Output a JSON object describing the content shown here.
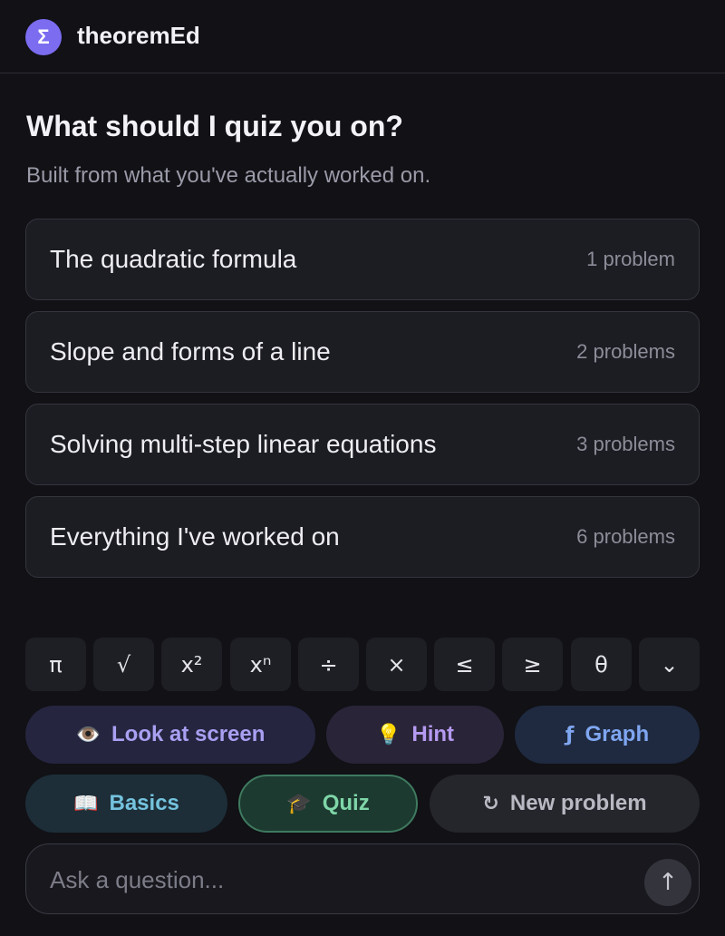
{
  "header": {
    "logo_glyph": "Σ",
    "title": "theoremEd"
  },
  "main": {
    "heading": "What should I quiz you on?",
    "subheading": "Built from what you've actually worked on.",
    "topics": [
      {
        "name": "The quadratic formula",
        "count": "1 problem"
      },
      {
        "name": "Slope and forms of a line",
        "count": "2 problems"
      },
      {
        "name": "Solving multi-step linear equations",
        "count": "3 problems"
      },
      {
        "name": "Everything I've worked on",
        "count": "6 problems"
      }
    ]
  },
  "symbols": [
    "π",
    "√",
    "x²",
    "xⁿ",
    "÷",
    "×",
    "≤",
    "≥",
    "θ",
    "⌄"
  ],
  "actions": {
    "look_icon": "eye-icon",
    "look_label": "Look at screen",
    "hint_icon": "lightbulb-icon",
    "hint_label": "Hint",
    "graph_icon": "function-icon",
    "graph_label": "Graph",
    "basics_icon": "book-icon",
    "basics_label": "Basics",
    "quiz_icon": "graduation-cap-icon",
    "quiz_label": "Quiz",
    "new_icon": "refresh-icon",
    "new_label": "New problem"
  },
  "input": {
    "placeholder": "Ask a question...",
    "value": ""
  },
  "glyphs": {
    "eye": "👁️",
    "bulb": "💡",
    "func": "ƒ",
    "book": "📖",
    "cap": "🎓",
    "refresh": "↻",
    "send": "↑"
  },
  "colors": {
    "background": "#111116",
    "logo": "#7b6cf0",
    "quiz_border": "#3f7a5f"
  }
}
